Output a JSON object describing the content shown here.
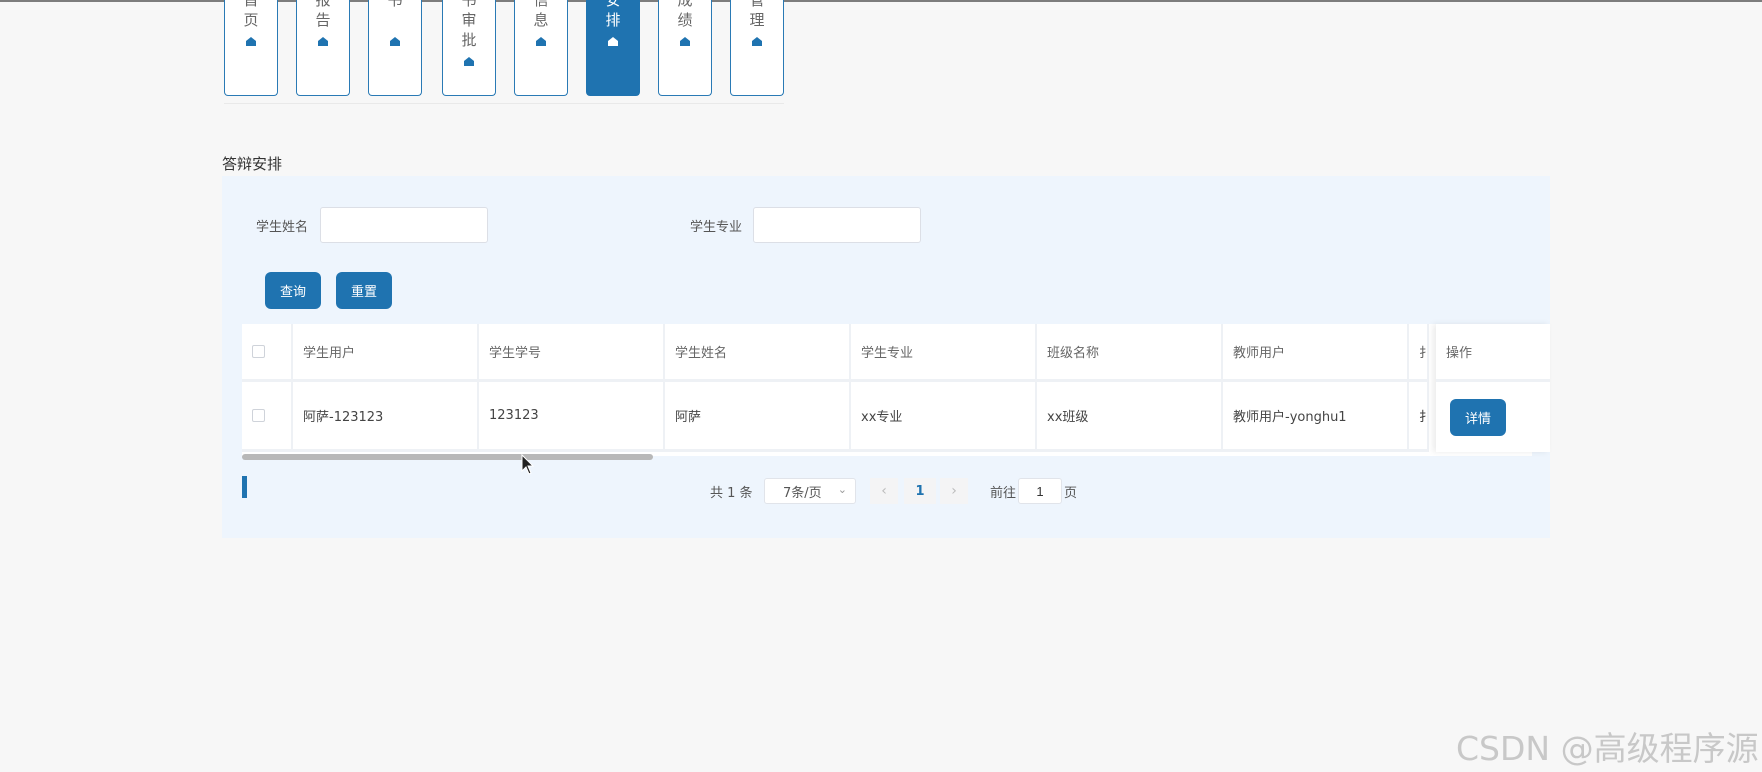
{
  "nav": {
    "tabs": [
      {
        "label": "首页",
        "active": false,
        "icon": "home-icon"
      },
      {
        "label": "报告",
        "active": false,
        "icon": "home-icon"
      },
      {
        "label": "书",
        "active": false,
        "icon": "home-icon"
      },
      {
        "label": "书审批",
        "active": false,
        "icon": "home-icon"
      },
      {
        "label": "信息",
        "active": false,
        "icon": "home-icon"
      },
      {
        "label": "安排",
        "active": true,
        "icon": "home-icon"
      },
      {
        "label": "成绩",
        "active": false,
        "icon": "home-icon"
      },
      {
        "label": "管理",
        "active": false,
        "icon": "home-icon"
      }
    ]
  },
  "section": {
    "title": "答辩安排"
  },
  "search": {
    "name_label": "学生姓名",
    "name_value": "",
    "major_label": "学生专业",
    "major_value": "",
    "query_label": "查询",
    "reset_label": "重置"
  },
  "table": {
    "columns": [
      "学生用户",
      "学生学号",
      "学生姓名",
      "学生专业",
      "班级名称",
      "教师用户",
      "扌"
    ],
    "ops_header": "操作",
    "rows": [
      {
        "cells": [
          "阿萨-123123",
          "123123",
          "阿萨",
          "xx专业",
          "xx班级",
          "教师用户-yonghu1",
          "扌"
        ],
        "detail_label": "详情"
      }
    ]
  },
  "pagination": {
    "total_text": "共 1 条",
    "page_size": "7条/页",
    "current_page": "1",
    "goto_label": "前往",
    "goto_value": "1",
    "page_suffix": "页"
  },
  "watermark": "CSDN @高级程序源",
  "colors": {
    "accent": "#1f73b0",
    "panel": "#eef5fd",
    "background": "#f7f7f7"
  }
}
